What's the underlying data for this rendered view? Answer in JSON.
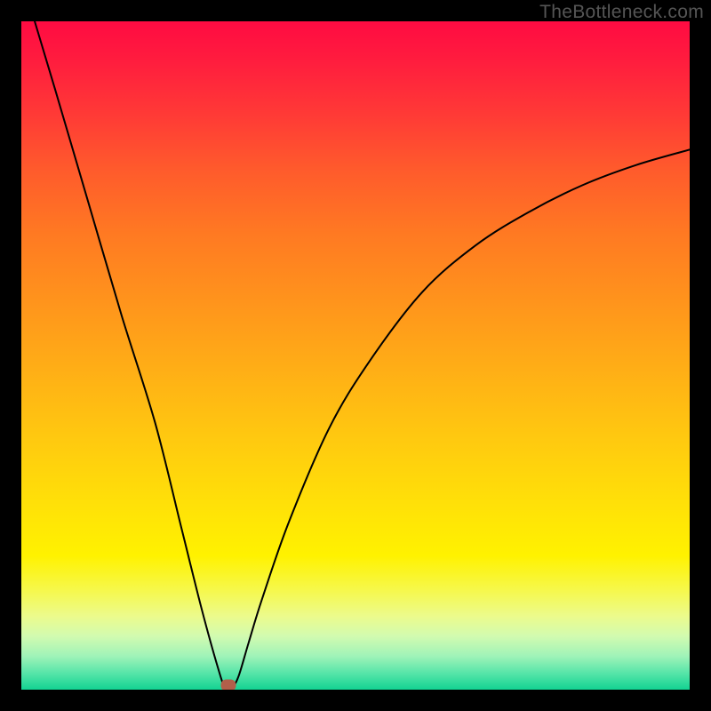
{
  "watermark": "TheBottleneck.com",
  "chart_data": {
    "type": "line",
    "title": "",
    "xlabel": "",
    "ylabel": "",
    "xlim": [
      0,
      100
    ],
    "ylim": [
      0,
      100
    ],
    "grid": false,
    "legend": false,
    "series": [
      {
        "name": "curve",
        "x": [
          2,
          5,
          10,
          15,
          20,
          24,
          27,
          29.5,
          30.5,
          31.5,
          32.5,
          34,
          36,
          40,
          46,
          52,
          60,
          68,
          76,
          84,
          92,
          100
        ],
        "y": [
          100,
          90,
          73,
          56,
          40,
          24,
          12,
          3,
          0.3,
          0.3,
          2,
          7,
          13.5,
          25,
          39,
          49,
          59.5,
          66.5,
          71.5,
          75.5,
          78.5,
          80.8
        ]
      }
    ],
    "annotations": [
      {
        "name": "marker",
        "x": 31,
        "y": 0.6,
        "shape": "rounded-rect",
        "color": "#b15f4a"
      }
    ],
    "background": {
      "type": "vertical-gradient",
      "stops": [
        {
          "pct": 0,
          "color": "#ff0b42"
        },
        {
          "pct": 50,
          "color": "#ffb414"
        },
        {
          "pct": 80,
          "color": "#fff200"
        },
        {
          "pct": 100,
          "color": "#13d392"
        }
      ]
    }
  },
  "marker": {
    "x_pct": 31,
    "y_pct": 0.6
  }
}
